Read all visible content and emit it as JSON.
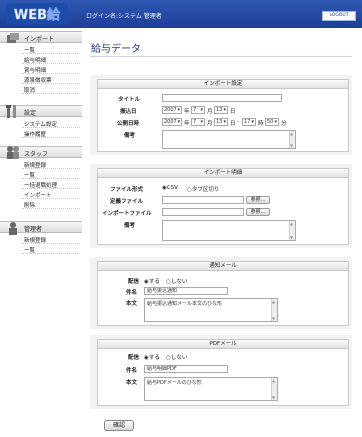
{
  "header": {
    "logo": "WEB給",
    "login_info": "ログイン名:システム 管理者",
    "logout": "LOGOUT"
  },
  "sidebar": {
    "import": {
      "title": "インポート",
      "items": [
        "一覧",
        "給与明細",
        "賞与明細",
        "源泉徴収票",
        "取消"
      ]
    },
    "settings": {
      "title": "設定",
      "items": [
        "システム設定",
        "操作履歴"
      ]
    },
    "staff": {
      "title": "スタッフ",
      "items": [
        "新規登録",
        "一覧",
        "一括退職処理",
        "インポート",
        "削除"
      ]
    },
    "admin": {
      "title": "管理者",
      "items": [
        "新規登録",
        "一覧"
      ]
    }
  },
  "main": {
    "title": "給与データ",
    "import_settings": {
      "heading": "インポート設定",
      "title_label": "タイトル",
      "title_value": "",
      "transfer_label": "振込日",
      "transfer": {
        "year": "2007",
        "month": "7",
        "day": "13"
      },
      "publish_label": "公開日時",
      "publish": {
        "year": "2007",
        "month": "7",
        "day": "13",
        "hour": "17",
        "minute": "50"
      },
      "unit_year": "年",
      "unit_month": "月",
      "unit_day": "日",
      "unit_hour": "時",
      "unit_minute": "分",
      "dash": "-",
      "note_label": "備考",
      "note_value": ""
    },
    "import_detail": {
      "heading": "インポート明細",
      "format_label": "ファイル形式",
      "format_options": [
        "CSV",
        "タブ区切り"
      ],
      "def_file_label": "定義ファイル",
      "import_file_label": "インポートファイル",
      "browse": "参照...",
      "note_label": "備考",
      "note_value": ""
    },
    "notify_mail": {
      "heading": "通知メール",
      "send_label": "配信",
      "send_options": [
        "する",
        "しない"
      ],
      "subject_label": "件名",
      "subject_value": "給与振込通知",
      "body_label": "本文",
      "body_value": "給与振込通知メール本文のひな形"
    },
    "pdf_mail": {
      "heading": "PDFメール",
      "send_label": "配信",
      "send_options": [
        "する",
        "しない"
      ],
      "subject_label": "件名",
      "subject_value": "給与明細PDF",
      "body_label": "本文",
      "body_value": "給与PDFメールのひな形"
    },
    "confirm": "確認"
  }
}
